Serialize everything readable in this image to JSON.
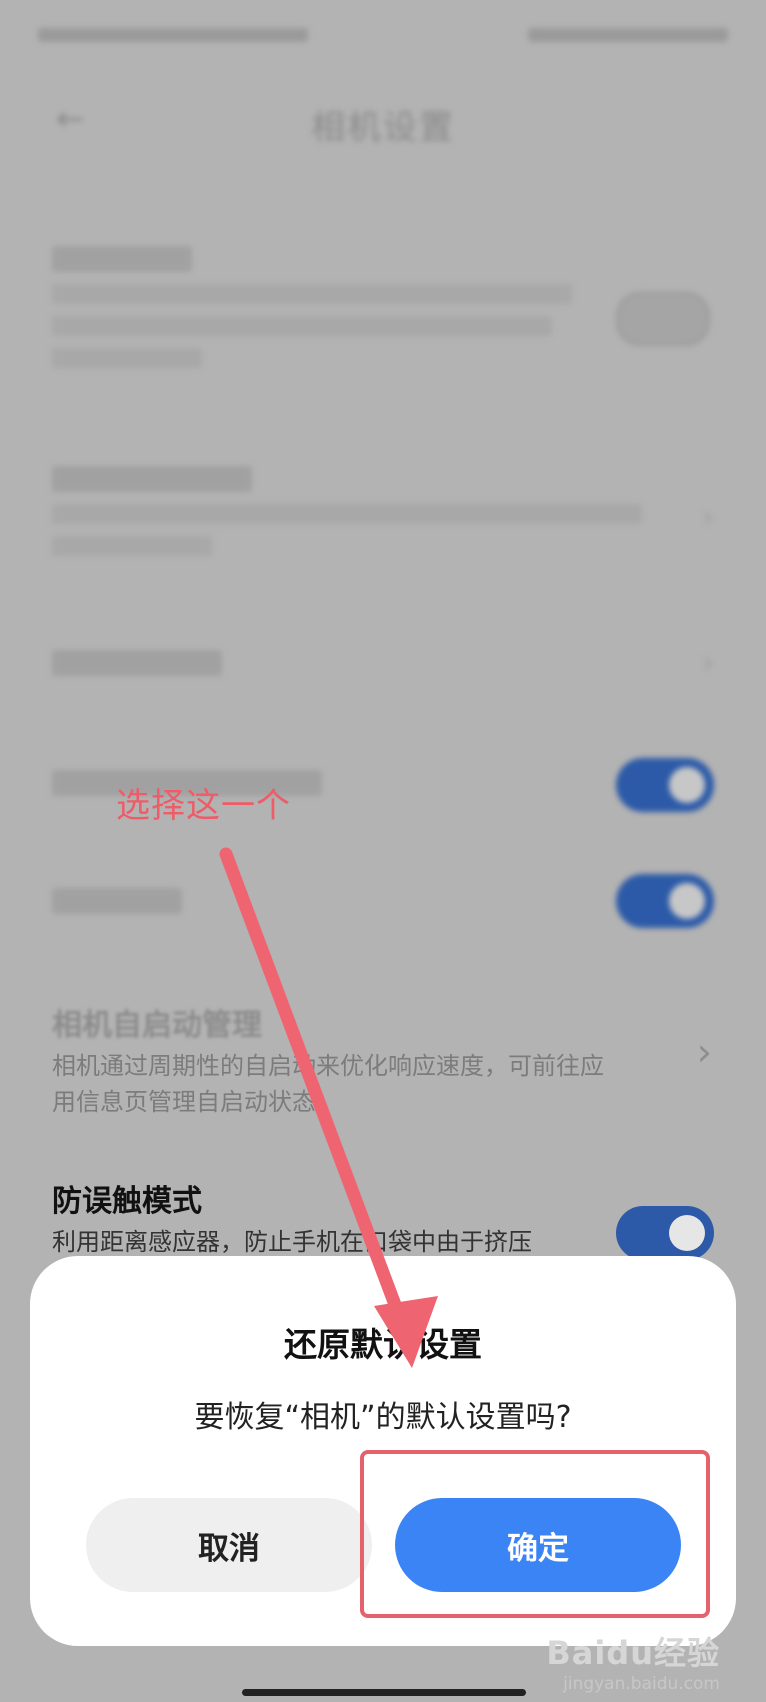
{
  "header": {
    "title": "相机设置"
  },
  "settings": {
    "auto_start_item": {
      "title": "相机自启动管理",
      "subtitle_line1": "相机通过周期性的自启动来优化响应速度，可前往应",
      "subtitle_line2": "用信息页管理自启动状态"
    },
    "mistouch_item": {
      "title": "防误触模式",
      "subtitle": "利用距离感应器，防止手机在口袋中由于挤压"
    }
  },
  "dialog": {
    "title": "还原默认设置",
    "message": "要恢复“相机”的默认设置吗?",
    "cancel_label": "取消",
    "confirm_label": "确定"
  },
  "annotation": {
    "text": "选择这一个",
    "color": "#ee5c68"
  },
  "watermark": {
    "logo": "Baidu经验",
    "sub": "jingyan.baidu.com"
  },
  "colors": {
    "toggle_on": "#2c5aa8",
    "confirm_button": "#3b84f5",
    "highlight_border": "#e5616c"
  }
}
